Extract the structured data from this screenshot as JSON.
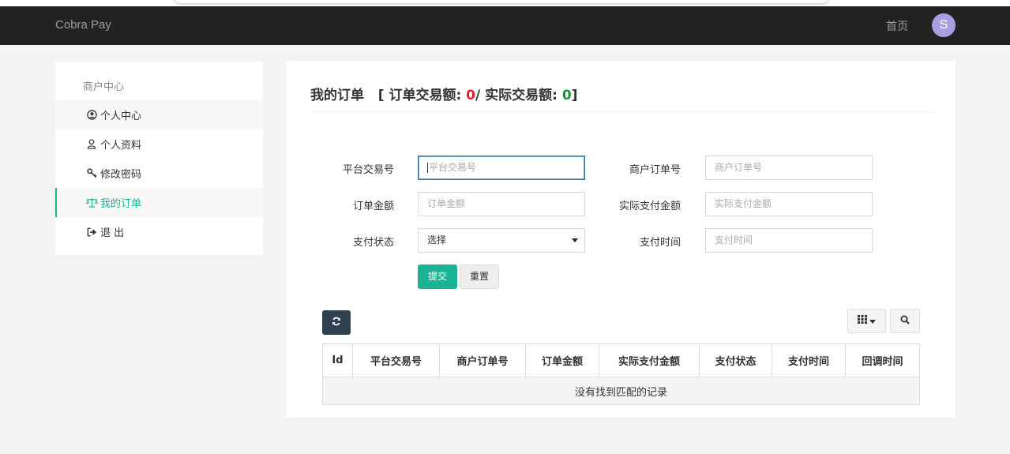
{
  "navbar": {
    "brand": "Cobra Pay",
    "home_link": "首页",
    "avatar_initial": "S"
  },
  "sidebar": {
    "title": "商户中心",
    "items": [
      {
        "label": "个人中心",
        "icon": "user-circle-icon"
      },
      {
        "label": "个人资料",
        "icon": "user-icon"
      },
      {
        "label": "修改密码",
        "icon": "key-icon"
      },
      {
        "label": "我的订单",
        "icon": "balance-scale-icon",
        "active": true
      },
      {
        "label": "退 出",
        "icon": "sign-out-icon"
      }
    ]
  },
  "main": {
    "title": "我的订单",
    "summary_prefix": "[ 订单交易额: ",
    "order_amount": "0",
    "summary_middle": "/ 实际交易额: ",
    "actual_amount": "0",
    "summary_suffix": "]"
  },
  "filters": {
    "platform_trade_no": {
      "label": "平台交易号",
      "placeholder": "平台交易号"
    },
    "merchant_order_no": {
      "label": "商户订单号",
      "placeholder": "商户订单号"
    },
    "order_amount": {
      "label": "订单金额",
      "placeholder": "订单金额"
    },
    "actual_amount": {
      "label": "实际支付金额",
      "placeholder": "实际支付金额"
    },
    "pay_status": {
      "label": "支付状态",
      "value": "选择"
    },
    "pay_time": {
      "label": "支付时间",
      "placeholder": "支付时间"
    },
    "submit_label": "提交",
    "reset_label": "重置"
  },
  "table": {
    "columns": [
      "Id",
      "平台交易号",
      "商户订单号",
      "订单金额",
      "实际支付金额",
      "支付状态",
      "支付时间",
      "回调时间"
    ],
    "empty_message": "没有找到匹配的记录"
  },
  "colors": {
    "accent": "#1ab394",
    "navbar": "#222222",
    "order_amount": "#e5202a",
    "actual_amount": "#1a8f3c",
    "avatar": "#a99fe0"
  }
}
